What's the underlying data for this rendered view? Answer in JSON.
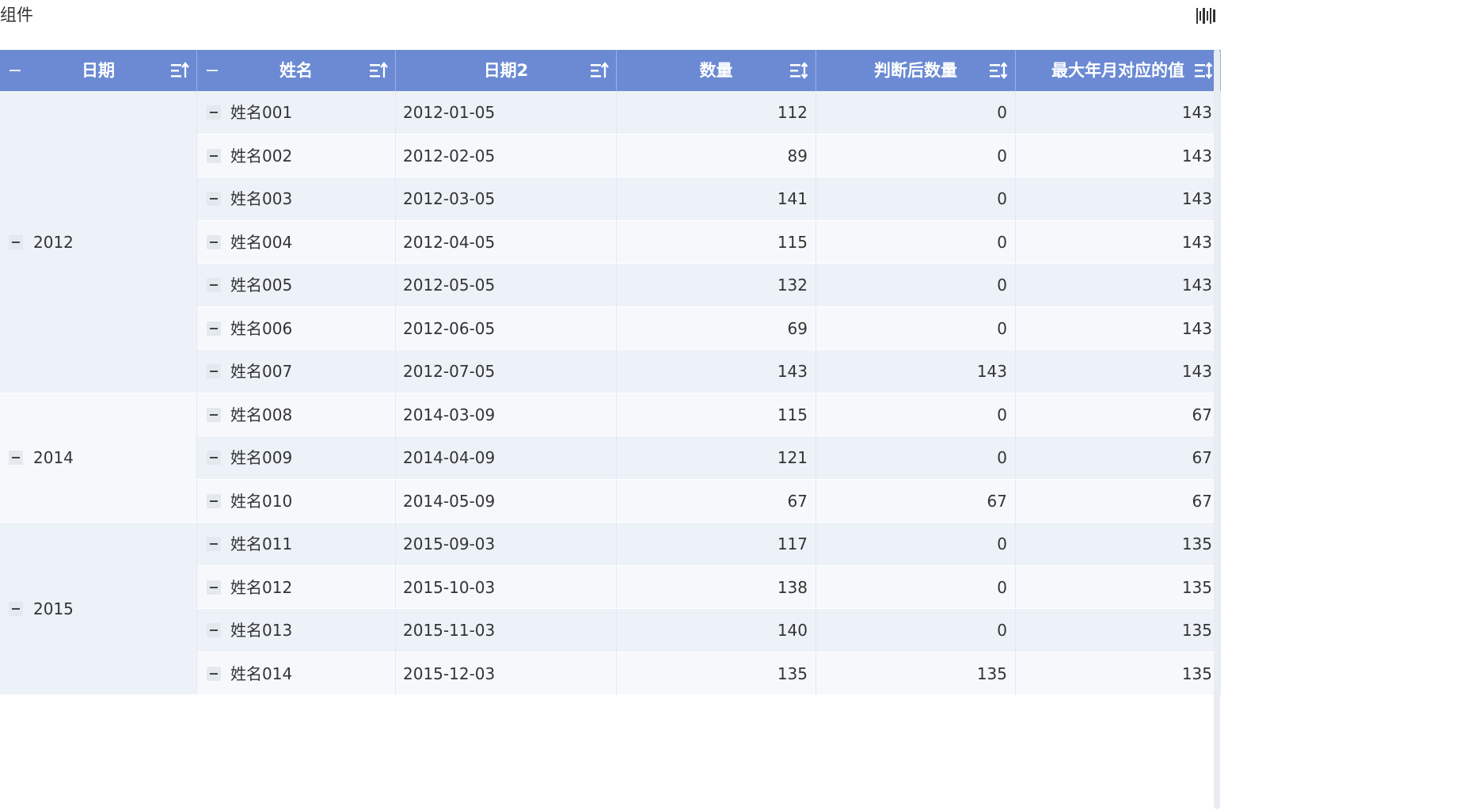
{
  "window": {
    "title": "组件"
  },
  "toolbar": {
    "icon": "barcode-icon"
  },
  "table": {
    "header_color": "#6b8ad3",
    "columns": [
      {
        "key": "date",
        "label": "日期",
        "collapsible": true,
        "sort_icon": "sort-asc-icon"
      },
      {
        "key": "name",
        "label": "姓名",
        "collapsible": true,
        "sort_icon": "sort-asc-icon"
      },
      {
        "key": "date2",
        "label": "日期2",
        "collapsible": false,
        "sort_icon": "sort-asc-icon"
      },
      {
        "key": "qty",
        "label": "数量",
        "collapsible": false,
        "sort_icon": "sort-both-icon"
      },
      {
        "key": "judged_qty",
        "label": "判断后数量",
        "collapsible": false,
        "sort_icon": "sort-both-icon"
      },
      {
        "key": "max_month_value",
        "label": "最大年月对应的值",
        "collapsible": false,
        "sort_icon": "sort-both-icon"
      }
    ],
    "groups": [
      {
        "year": "2012",
        "rows": [
          {
            "name": "姓名001",
            "date2": "2012-01-05",
            "qty": "112",
            "judged_qty": "0",
            "max_month_value": "143"
          },
          {
            "name": "姓名002",
            "date2": "2012-02-05",
            "qty": "89",
            "judged_qty": "0",
            "max_month_value": "143"
          },
          {
            "name": "姓名003",
            "date2": "2012-03-05",
            "qty": "141",
            "judged_qty": "0",
            "max_month_value": "143"
          },
          {
            "name": "姓名004",
            "date2": "2012-04-05",
            "qty": "115",
            "judged_qty": "0",
            "max_month_value": "143"
          },
          {
            "name": "姓名005",
            "date2": "2012-05-05",
            "qty": "132",
            "judged_qty": "0",
            "max_month_value": "143"
          },
          {
            "name": "姓名006",
            "date2": "2012-06-05",
            "qty": "69",
            "judged_qty": "0",
            "max_month_value": "143"
          },
          {
            "name": "姓名007",
            "date2": "2012-07-05",
            "qty": "143",
            "judged_qty": "143",
            "max_month_value": "143"
          }
        ]
      },
      {
        "year": "2014",
        "rows": [
          {
            "name": "姓名008",
            "date2": "2014-03-09",
            "qty": "115",
            "judged_qty": "0",
            "max_month_value": "67"
          },
          {
            "name": "姓名009",
            "date2": "2014-04-09",
            "qty": "121",
            "judged_qty": "0",
            "max_month_value": "67"
          },
          {
            "name": "姓名010",
            "date2": "2014-05-09",
            "qty": "67",
            "judged_qty": "67",
            "max_month_value": "67"
          }
        ]
      },
      {
        "year": "2015",
        "rows": [
          {
            "name": "姓名011",
            "date2": "2015-09-03",
            "qty": "117",
            "judged_qty": "0",
            "max_month_value": "135"
          },
          {
            "name": "姓名012",
            "date2": "2015-10-03",
            "qty": "138",
            "judged_qty": "0",
            "max_month_value": "135"
          },
          {
            "name": "姓名013",
            "date2": "2015-11-03",
            "qty": "140",
            "judged_qty": "0",
            "max_month_value": "135"
          },
          {
            "name": "姓名014",
            "date2": "2015-12-03",
            "qty": "135",
            "judged_qty": "135",
            "max_month_value": "135"
          }
        ]
      }
    ]
  }
}
